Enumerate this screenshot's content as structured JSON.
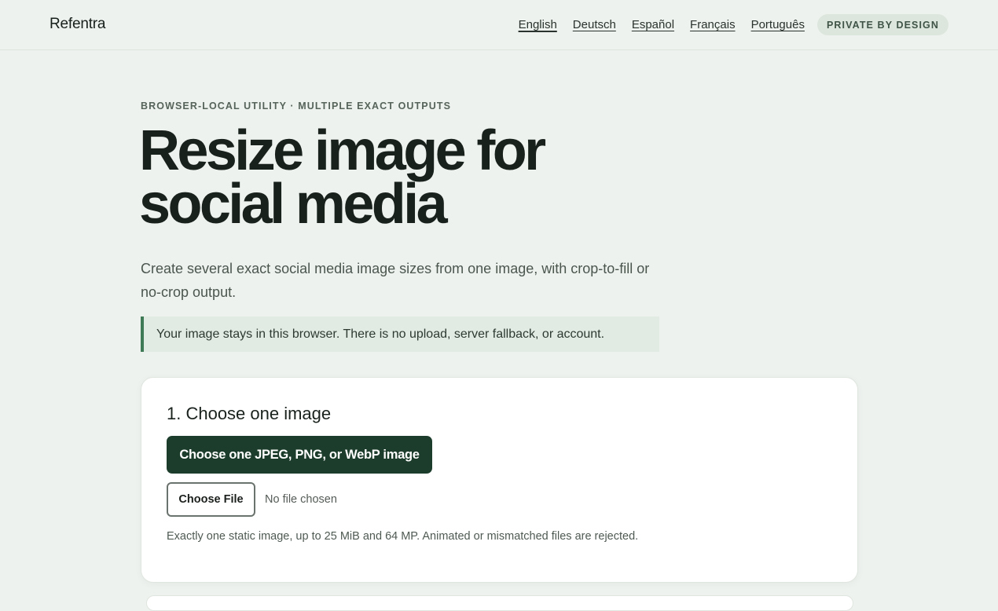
{
  "header": {
    "brand": "Refentra",
    "languages": [
      "English",
      "Deutsch",
      "Español",
      "Français",
      "Português"
    ],
    "badge": "PRIVATE BY DESIGN"
  },
  "hero": {
    "eyebrow": "BROWSER-LOCAL UTILITY · MULTIPLE EXACT OUTPUTS",
    "title_line1": "Resize image for",
    "title_line2": "social media",
    "lede": "Create several exact social media image sizes from one image, with crop-to-fill or no-crop output.",
    "notice": "Your image stays in this browser. There is no upload, server fallback, or account."
  },
  "step1": {
    "title": "1. Choose one image",
    "choose_button": "Choose one JPEG, PNG, or WebP image",
    "file_button": "Choose File",
    "file_status": "No file chosen",
    "hint": "Exactly one static image, up to 25 MiB and 64 MP. Animated or mismatched files are rejected."
  }
}
